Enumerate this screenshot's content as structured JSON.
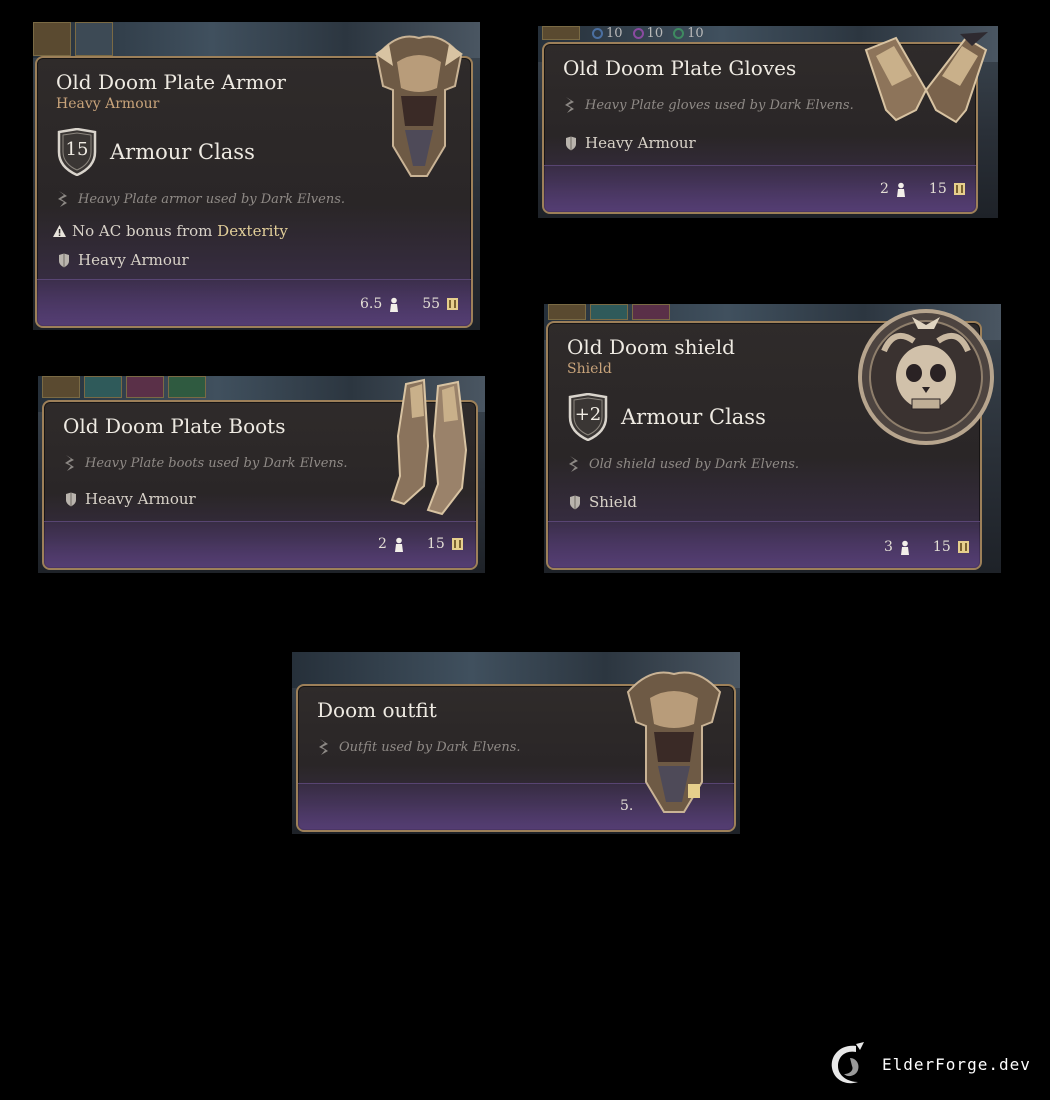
{
  "tooltips": {
    "armor": {
      "title": "Old Doom Plate Armor",
      "subtitle": "Heavy Armour",
      "armour_class_value": "15",
      "armour_class_label": "Armour Class",
      "description": "Heavy Plate armor used by Dark Elvens.",
      "warning_prefix": "No AC bonus from ",
      "warning_stat": "Dexterity",
      "proficiency": "Heavy Armour",
      "weight": "6.5",
      "price": "55"
    },
    "gloves": {
      "title": "Old Doom Plate Gloves",
      "description": "Heavy Plate gloves used by Dark Elvens.",
      "proficiency": "Heavy Armour",
      "weight": "2",
      "price": "15",
      "top_stats": [
        "10",
        "10",
        "10"
      ]
    },
    "boots": {
      "title": "Old Doom Plate Boots",
      "description": "Heavy Plate boots used by Dark Elvens.",
      "proficiency": "Heavy Armour",
      "weight": "2",
      "price": "15"
    },
    "shield": {
      "title": "Old Doom shield",
      "subtitle": "Shield",
      "armour_class_value": "+2",
      "armour_class_label": "Armour Class",
      "description": "Old shield used by Dark Elvens.",
      "proficiency": "Shield",
      "weight": "3",
      "price": "15"
    },
    "outfit": {
      "title": "Doom outfit",
      "description": "Outfit used by Dark Elvens.",
      "weight": "5."
    }
  },
  "watermark": {
    "text": "ElderForge.dev"
  },
  "colors": {
    "frame": "#9d8059",
    "subtitle": "#c8a37a",
    "dexterity": "#e2cf9a",
    "footer": "#4a3764"
  },
  "icons": [
    "description-quill-icon",
    "armour-proficiency-icon",
    "warning-icon",
    "weight-icon",
    "gold-coin-icon",
    "armour-class-shield-icon"
  ]
}
